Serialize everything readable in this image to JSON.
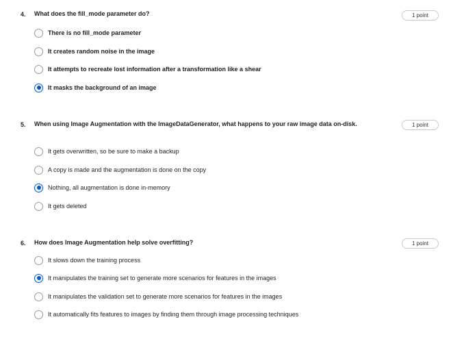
{
  "questions": [
    {
      "number": "4.",
      "text": "What does the fill_mode parameter do?",
      "points": "1 point",
      "options": [
        {
          "label": "There is no fill_mode parameter",
          "selected": false
        },
        {
          "label": "It creates random noise in the image",
          "selected": false
        },
        {
          "label": "It attempts to recreate lost information after a transformation like a shear",
          "selected": false
        },
        {
          "label": "It masks the background of an image",
          "selected": true
        }
      ]
    },
    {
      "number": "5.",
      "text": "When using Image Augmentation with the ImageDataGenerator, what happens to your raw image data on-disk.",
      "points": "1 point",
      "options": [
        {
          "label": "It gets overwritten, so be sure to make a backup",
          "selected": false
        },
        {
          "label": "A copy is made and the augmentation is done on the copy",
          "selected": false
        },
        {
          "label": "Nothing, all augmentation is done in-memory",
          "selected": true
        },
        {
          "label": "It gets deleted",
          "selected": false
        }
      ]
    },
    {
      "number": "6.",
      "text": "How does Image Augmentation help solve overfitting?",
      "points": "1 point",
      "options": [
        {
          "label": "It slows down the training process",
          "selected": false
        },
        {
          "label": "It manipulates the training set to generate more scenarios for features in the images",
          "selected": true
        },
        {
          "label": "It manipulates the validation set to generate more scenarios for features in the images",
          "selected": false
        },
        {
          "label": "It automatically fits features to images by finding them through image processing techniques",
          "selected": false
        }
      ]
    }
  ],
  "colors": {
    "accent": "#0056d2",
    "radio_border": "#9a9a9a",
    "text": "#1f1f1f",
    "pill_border": "#c9c9c9"
  }
}
